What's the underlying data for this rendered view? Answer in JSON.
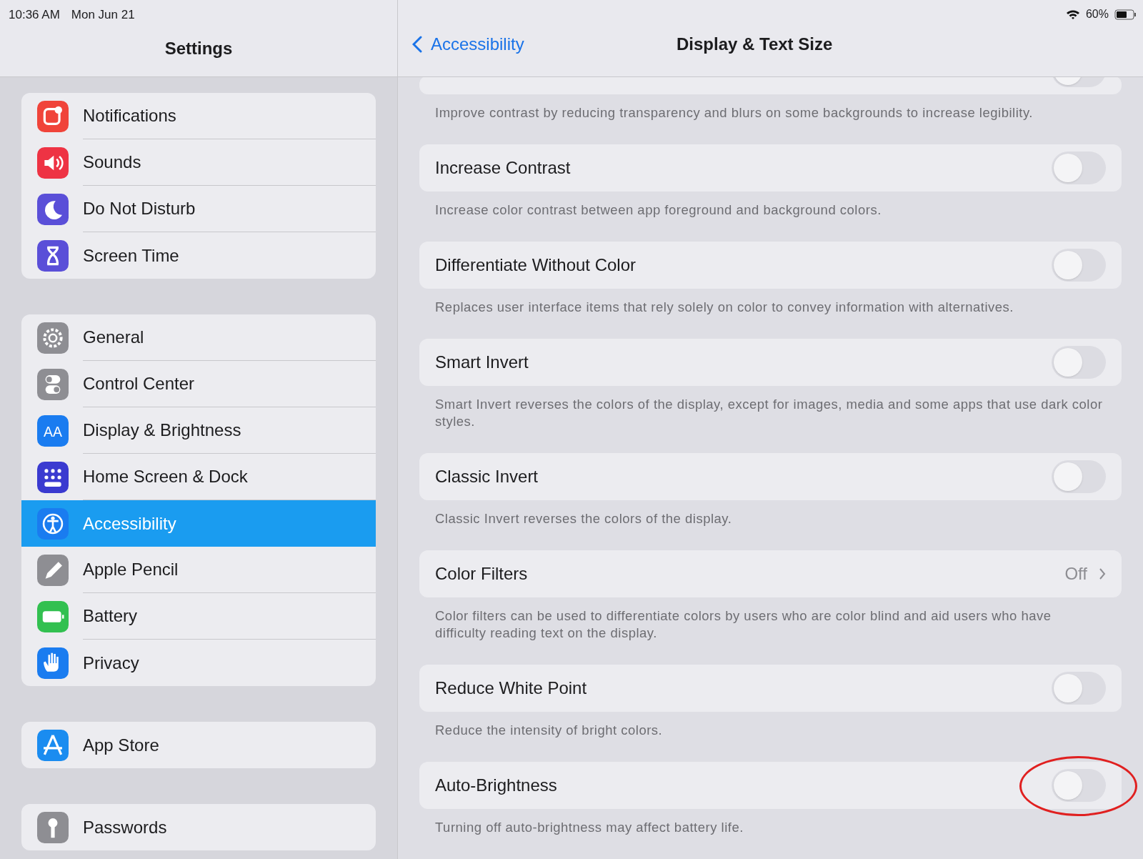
{
  "status_bar": {
    "time": "10:36 AM",
    "date": "Mon Jun 21",
    "battery": "60%"
  },
  "sidebar": {
    "title": "Settings",
    "groups": [
      [
        {
          "label": "Notifications",
          "color": "#f0443a",
          "selected": false
        },
        {
          "label": "Sounds",
          "color": "#ee3344",
          "selected": false
        },
        {
          "label": "Do Not Disturb",
          "color": "#5a4fd8",
          "selected": false
        },
        {
          "label": "Screen Time",
          "color": "#5a4fd8",
          "selected": false
        }
      ],
      [
        {
          "label": "General",
          "color": "#8e8e93",
          "selected": false
        },
        {
          "label": "Control Center",
          "color": "#8e8e93",
          "selected": false
        },
        {
          "label": "Display & Brightness",
          "color": "#1a7cf0",
          "icon_text": "AA",
          "selected": false
        },
        {
          "label": "Home Screen & Dock",
          "color": "#3a3ad0",
          "selected": false
        },
        {
          "label": "Accessibility",
          "color": "#1a7cf0",
          "selected": true
        },
        {
          "label": "Apple Pencil",
          "color": "#8e8e93",
          "selected": false
        },
        {
          "label": "Battery",
          "color": "#32c050",
          "selected": false
        },
        {
          "label": "Privacy",
          "color": "#1a7cf0",
          "selected": false
        }
      ],
      [
        {
          "label": "App Store",
          "color": "#1a8cf0",
          "selected": false
        }
      ],
      [
        {
          "label": "Passwords",
          "color": "#8e8e93",
          "selected": false
        }
      ]
    ]
  },
  "detail": {
    "back": "Accessibility",
    "title": "Display & Text Size",
    "rows": [
      {
        "kind": "partial",
        "on": false,
        "description": "Improve contrast by reducing transparency and blurs on some backgrounds to increase legibility."
      },
      {
        "kind": "toggle",
        "label": "Increase Contrast",
        "on": false,
        "description": "Increase color contrast between app foreground and background colors."
      },
      {
        "kind": "toggle",
        "label": "Differentiate Without Color",
        "on": false,
        "description": "Replaces user interface items that rely solely on color to convey information with alternatives."
      },
      {
        "kind": "toggle",
        "label": "Smart Invert",
        "on": false,
        "description": "Smart Invert reverses the colors of the display, except for images, media and some apps that use dark color styles."
      },
      {
        "kind": "toggle",
        "label": "Classic Invert",
        "on": false,
        "description": "Classic Invert reverses the colors of the display."
      },
      {
        "kind": "disclosure",
        "label": "Color Filters",
        "value": "Off",
        "description": "Color filters can be used to differentiate colors by users who are color blind and aid users who have difficulty reading text on the display."
      },
      {
        "kind": "toggle",
        "label": "Reduce White Point",
        "on": false,
        "description": "Reduce the intensity of bright colors."
      },
      {
        "kind": "toggle",
        "label": "Auto-Brightness",
        "on": false,
        "circled": true,
        "description": "Turning off auto-brightness may affect battery life."
      }
    ]
  }
}
